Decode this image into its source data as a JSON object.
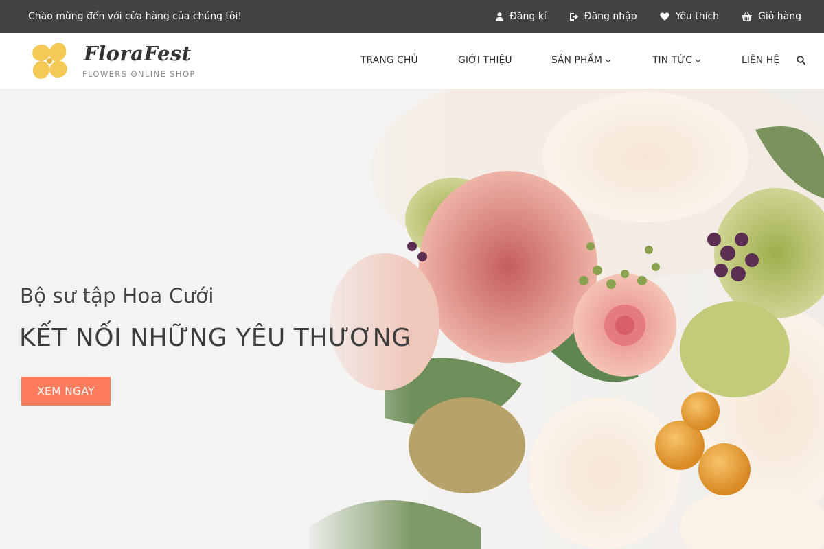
{
  "topbar": {
    "welcome": "Chào mừng đến với cửa hàng của chúng tôi!",
    "links": [
      {
        "label": "Đăng kí",
        "icon": "user-icon"
      },
      {
        "label": "Đăng nhập",
        "icon": "sign-in-icon"
      },
      {
        "label": "Yêu thích",
        "icon": "heart-icon"
      },
      {
        "label": "Giỏ hàng",
        "icon": "basket-icon"
      }
    ]
  },
  "header": {
    "logo_name": "FloraFest",
    "logo_tagline": "FLOWERS ONLINE SHOP",
    "nav": [
      {
        "label": "TRANG CHỦ",
        "has_dropdown": false
      },
      {
        "label": "GIỚI THIỆU",
        "has_dropdown": false
      },
      {
        "label": "SẢN PHẨM",
        "has_dropdown": true
      },
      {
        "label": "TIN TỨC",
        "has_dropdown": true
      },
      {
        "label": "LIÊN HỆ",
        "has_dropdown": false
      }
    ],
    "search_icon": "search-icon"
  },
  "hero": {
    "subtitle": "Bộ sư tập Hoa Cưới",
    "title": "KẾT NỐI NHỮNG YÊU THƯƠNG",
    "button_label": "XEM NGAY"
  },
  "colors": {
    "topbar_bg": "#434343",
    "accent": "#fb7b5c",
    "logo_yellow": "#f5c955"
  }
}
